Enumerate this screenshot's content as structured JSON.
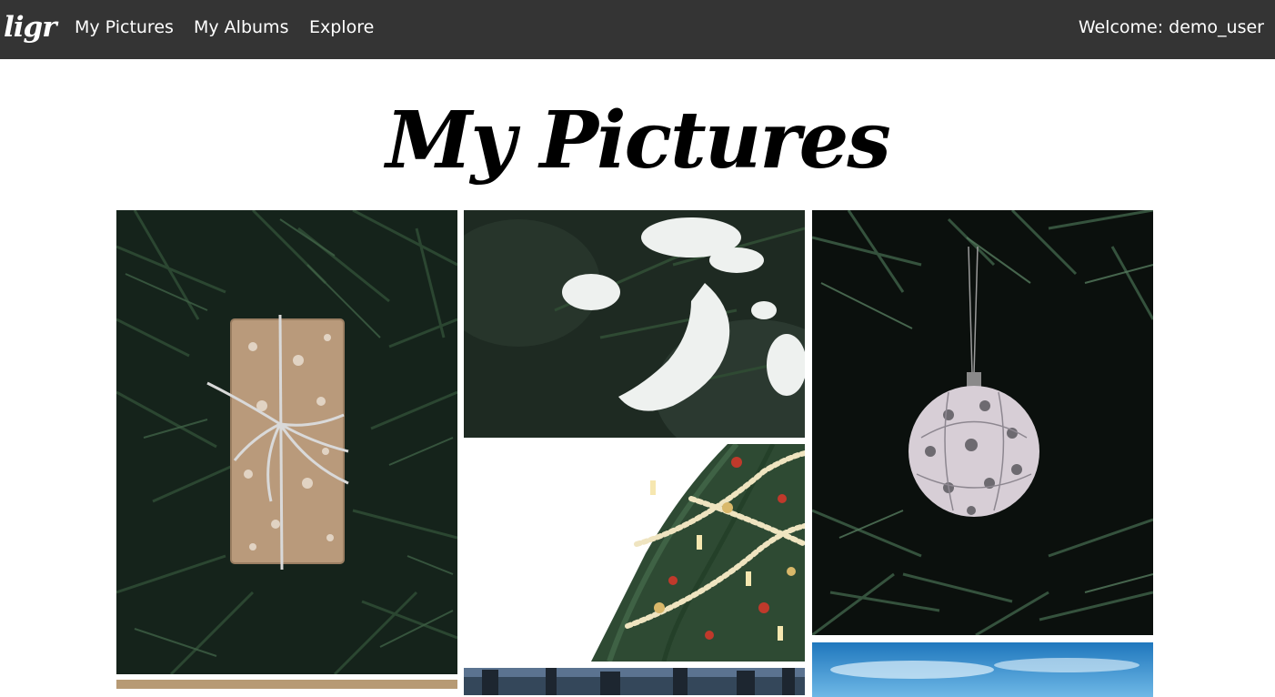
{
  "navbar": {
    "brand": "ligr",
    "links": [
      {
        "label": "My Pictures"
      },
      {
        "label": "My Albums"
      },
      {
        "label": "Explore"
      }
    ],
    "welcome": "Welcome: demo_user"
  },
  "page": {
    "title": "My Pictures"
  },
  "colors": {
    "navbar_bg": "#343434",
    "navbar_text": "#ffffff",
    "page_bg": "#ffffff",
    "title_text": "#000000"
  }
}
